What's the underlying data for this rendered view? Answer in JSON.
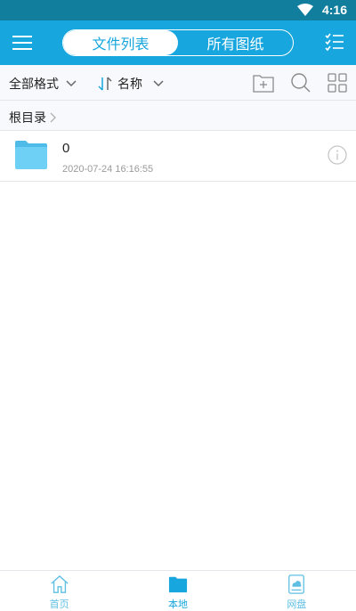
{
  "status_bar": {
    "time": "4:16"
  },
  "header": {
    "tabs": [
      {
        "label": "文件列表",
        "active": true
      },
      {
        "label": "所有图纸",
        "active": false
      }
    ]
  },
  "toolbar": {
    "filter_label": "全部格式",
    "sort_label": "名称"
  },
  "breadcrumb": {
    "root": "根目录"
  },
  "files": [
    {
      "name": "0",
      "date": "2020-07-24 16:16:55",
      "type": "folder"
    }
  ],
  "bottom_nav": {
    "items": [
      {
        "label": "首页",
        "icon": "home-icon",
        "active": false
      },
      {
        "label": "本地",
        "icon": "folder-icon",
        "active": true
      },
      {
        "label": "网盘",
        "icon": "cloud-disk-icon",
        "active": false
      }
    ]
  },
  "colors": {
    "accent": "#17a6dd",
    "status_bar": "#127e9d",
    "folder": "#5ac8f0"
  }
}
